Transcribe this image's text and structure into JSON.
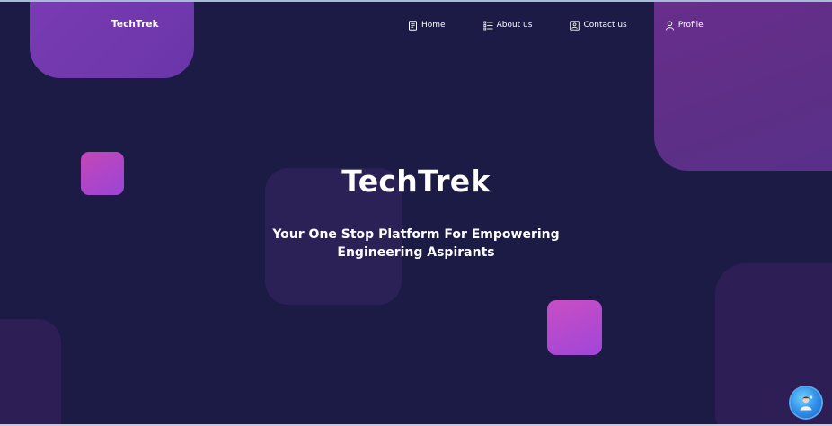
{
  "brand": {
    "name": "TechTrek"
  },
  "nav": {
    "items": [
      {
        "label": "Home",
        "icon": "document-icon"
      },
      {
        "label": "About us",
        "icon": "list-icon"
      },
      {
        "label": "Contact us",
        "icon": "contact-card-icon"
      },
      {
        "label": "Profile",
        "icon": "user-icon"
      }
    ]
  },
  "hero": {
    "title": "TechTrek",
    "subtitle_line1": "Your One Stop Platform For Empowering",
    "subtitle_line2": "Engineering Aspirants"
  },
  "chat": {
    "icon": "assistant-avatar-icon"
  },
  "colors": {
    "background": "#1b1b45",
    "accent_purple": "#7b3bb3",
    "accent_pink": "#c446b9",
    "text": "#ffffff"
  }
}
